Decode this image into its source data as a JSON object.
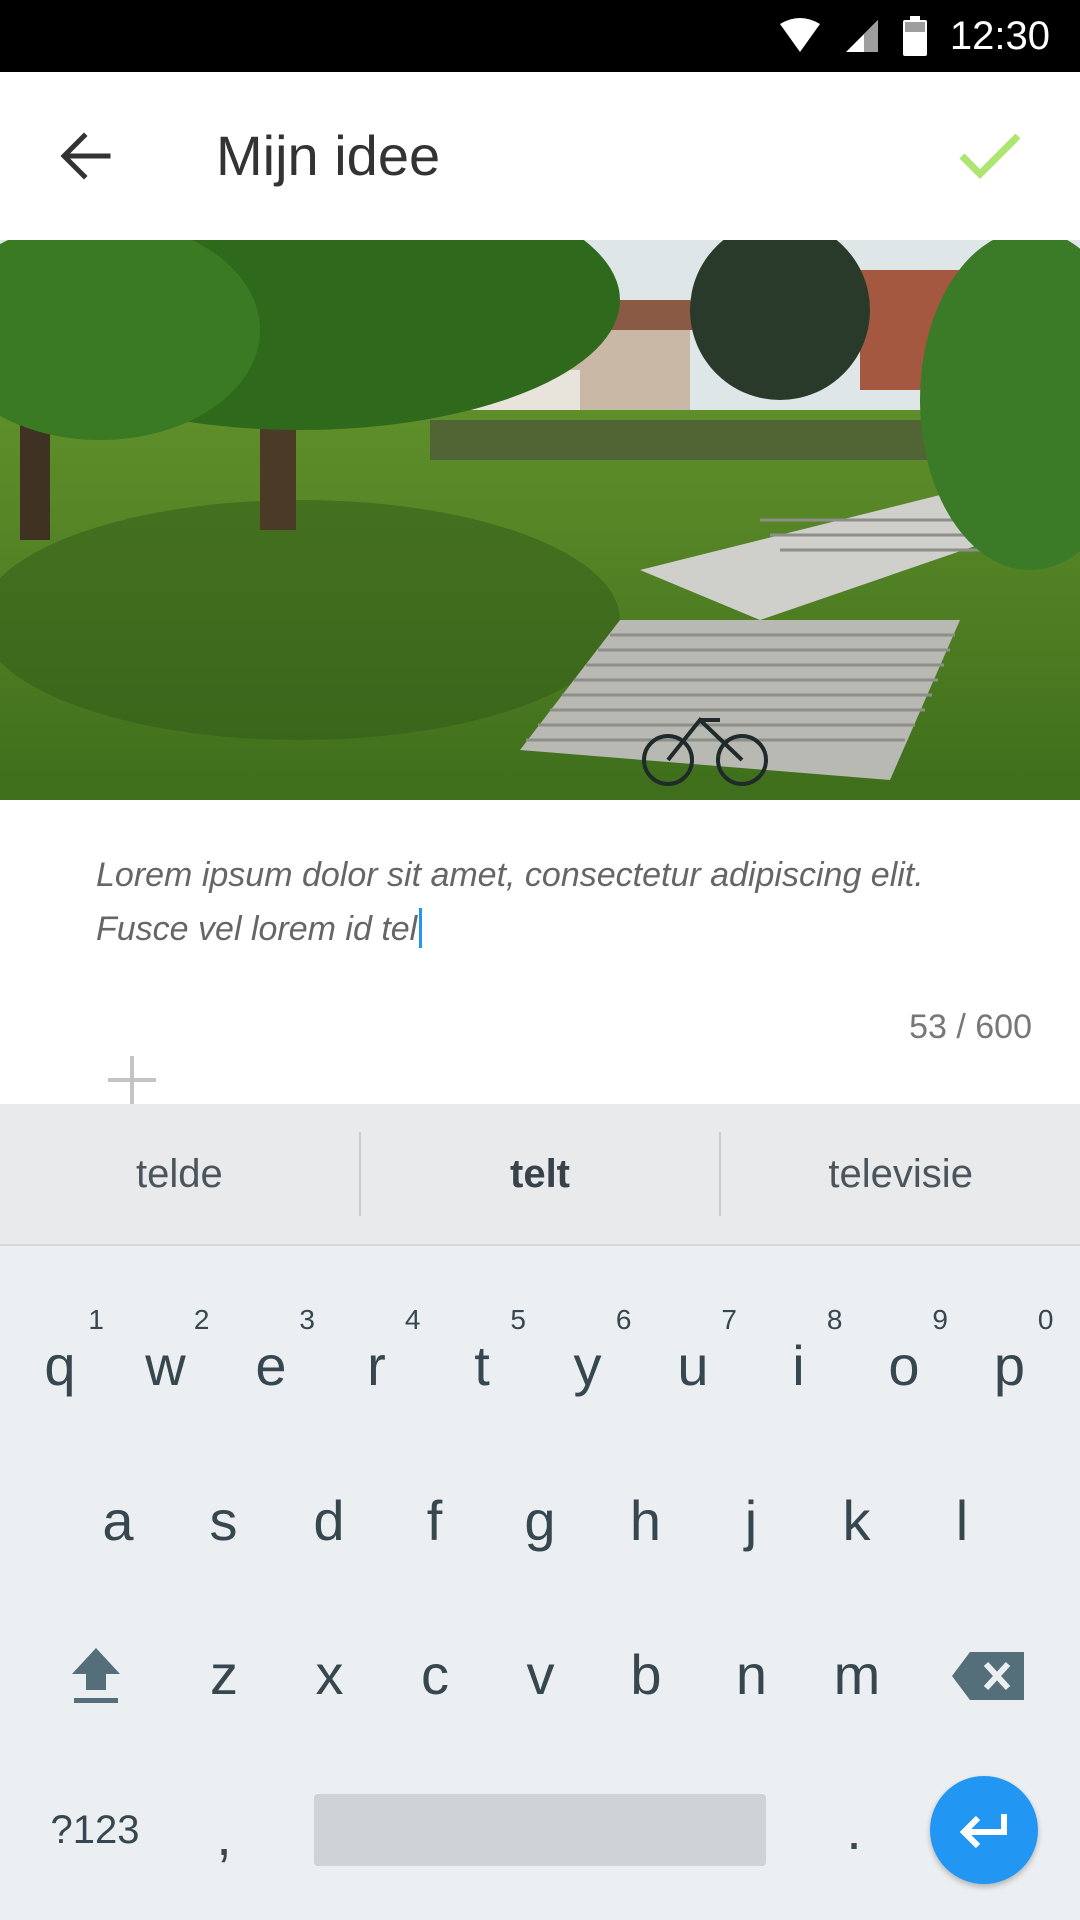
{
  "status_bar": {
    "time": "12:30"
  },
  "app_bar": {
    "title": "Mijn idee",
    "accent_color": "#aee571"
  },
  "editor": {
    "text_line1": "Lorem ipsum dolor sit amet, consectetur adipiscing elit.",
    "text_line2": "Fusce vel lorem id tel",
    "char_count": "53 / 600"
  },
  "keyboard": {
    "suggestions": [
      "telde",
      "telt",
      "televisie"
    ],
    "row1": [
      {
        "key": "q",
        "hint": "1"
      },
      {
        "key": "w",
        "hint": "2"
      },
      {
        "key": "e",
        "hint": "3"
      },
      {
        "key": "r",
        "hint": "4"
      },
      {
        "key": "t",
        "hint": "5"
      },
      {
        "key": "y",
        "hint": "6"
      },
      {
        "key": "u",
        "hint": "7"
      },
      {
        "key": "i",
        "hint": "8"
      },
      {
        "key": "o",
        "hint": "9"
      },
      {
        "key": "p",
        "hint": "0"
      }
    ],
    "row2": [
      "a",
      "s",
      "d",
      "f",
      "g",
      "h",
      "j",
      "k",
      "l"
    ],
    "row3": [
      "z",
      "x",
      "c",
      "v",
      "b",
      "n",
      "m"
    ],
    "symbols_label": "?123",
    "comma": ",",
    "period": ".",
    "enter_color": "#2196f3"
  }
}
